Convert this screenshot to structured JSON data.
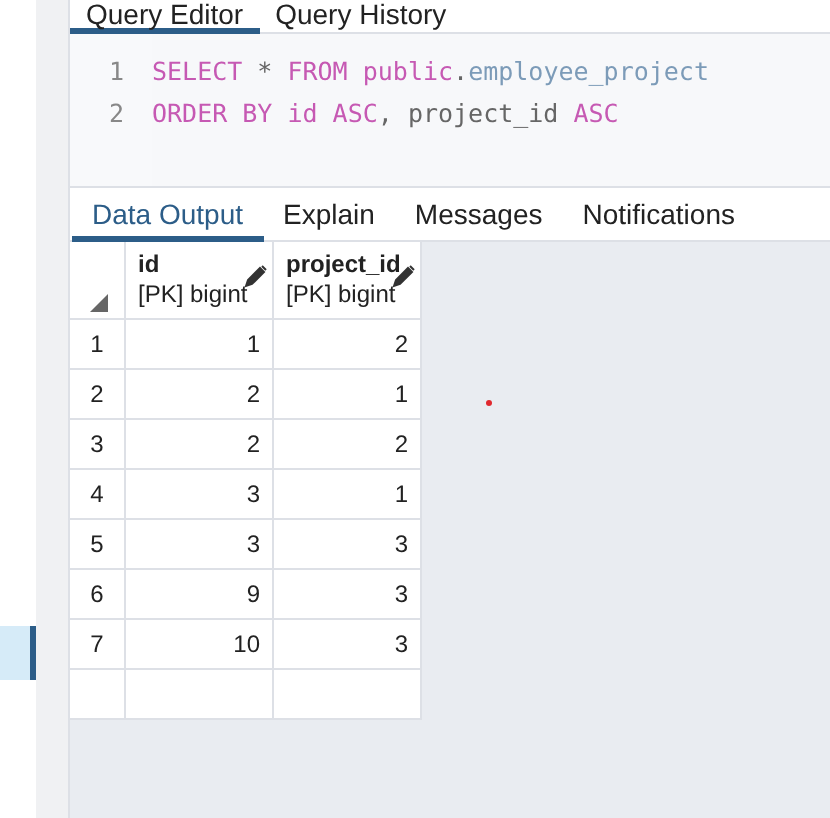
{
  "editor_tabs": [
    {
      "label": "Query Editor",
      "selected": true
    },
    {
      "label": "Query History",
      "selected": false
    }
  ],
  "editor": {
    "lines": [
      {
        "number": "1",
        "tokens": [
          {
            "kind": "keyword",
            "text": "SELECT"
          },
          {
            "kind": "plain",
            "text": " * "
          },
          {
            "kind": "keyword",
            "text": "FROM public"
          },
          {
            "kind": "plain",
            "text": "."
          },
          {
            "kind": "ident",
            "text": "employee_project"
          }
        ]
      },
      {
        "number": "2",
        "tokens": [
          {
            "kind": "keyword",
            "text": "ORDER BY id ASC"
          },
          {
            "kind": "plain",
            "text": ", project_id "
          },
          {
            "kind": "keyword",
            "text": "ASC"
          }
        ]
      }
    ]
  },
  "sidebar": {
    "items": [
      {
        "selected": true
      }
    ]
  },
  "result_tabs": [
    {
      "label": "Data Output",
      "selected": true
    },
    {
      "label": "Explain",
      "selected": false
    },
    {
      "label": "Messages",
      "selected": false
    },
    {
      "label": "Notifications",
      "selected": false
    }
  ],
  "table": {
    "columns": [
      {
        "name": "id",
        "type": "[PK] bigint"
      },
      {
        "name": "project_id",
        "type": "[PK] bigint"
      }
    ],
    "rows": [
      {
        "number": "1",
        "cells": [
          "1",
          "2"
        ]
      },
      {
        "number": "2",
        "cells": [
          "2",
          "1"
        ]
      },
      {
        "number": "3",
        "cells": [
          "2",
          "2"
        ]
      },
      {
        "number": "4",
        "cells": [
          "3",
          "1"
        ]
      },
      {
        "number": "5",
        "cells": [
          "3",
          "3"
        ]
      },
      {
        "number": "6",
        "cells": [
          "9",
          "3"
        ]
      },
      {
        "number": "7",
        "cells": [
          "10",
          "3"
        ]
      }
    ]
  }
}
